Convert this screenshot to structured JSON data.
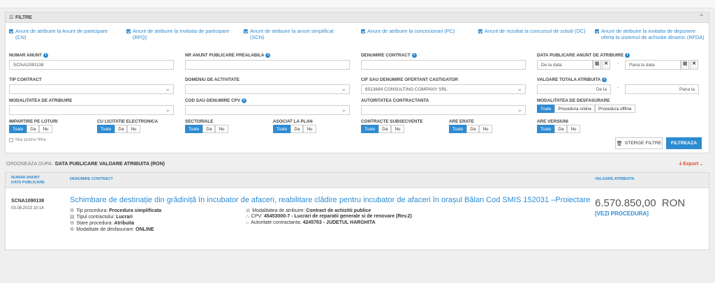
{
  "filters_header": {
    "title": "FILTRE"
  },
  "checkboxes": [
    "Anunt de atribuire la Anunt de participare (CN)",
    "Anunt de atribuire la invitatia de participare (RFQ)",
    "Anunt de atribuire la anunt simplificat (SCN)",
    "Anunt de atribuire la concesionari (PC)",
    "Anunt de rezultat la concursul de solutii (DC)",
    "Anunt de atribuire la invitatia de depunere oferta la sistemul de achizitie dinamic (RFDA)"
  ],
  "labels": {
    "numar_anunt": "NUMAR ANUNT",
    "nr_anunt_prealabil": "NR ANUNT PUBLICARE PREALABILA",
    "denumire_contract": "DENUMIRE CONTRACT",
    "data_publicare": "DATA PUBLICARE ANUNT DE ATRIBUIRE",
    "tip_contract": "TIP CONTRACT",
    "domeniu": "DOMENIU DE ACTIVITATE",
    "cif": "CIF SAU DENUMIRE OFERTANT CASTIGATOR",
    "valoare": "VALOARE TOTALA ATRIBUITA",
    "modalitate_atribuire": "MODALITATEA DE ATRIBUIRE",
    "cpv": "COD SAU DENUMIRE CPV",
    "autoritate": "AUTORITATEA CONTRACTANTA",
    "modalitate_desfasurare": "MODALITATEA DE DESFASURARE",
    "loturi": "IMPARTIRE PE LOTURI",
    "licitatie": "CU LICITATIE ELECTRONICA",
    "sectoriale": "SECTORIALE",
    "asociat": "ASOCIAT LA PLAN",
    "contracte": "CONTRACTE SUBSECVENTE",
    "erate": "ARE ERATE",
    "versiuni": "ARE VERSIUNI"
  },
  "values": {
    "numar_anunt": "SCNA1090138",
    "data_de_la": "De la data",
    "data_pana_la": "Pana la data",
    "cif": "6513684 CONSULTING COMPANY SRL",
    "valoare_de_la": "De la",
    "valoare_pana_la": "Pana la"
  },
  "seg": {
    "toate": "Toate",
    "da": "Da",
    "nu": "Nu"
  },
  "desfasurare": [
    "Toate",
    "Procedura online",
    "Procedura offline"
  ],
  "mai_putine": "Mai putine filtre",
  "buttons": {
    "sterge": "STERGE FILTRE",
    "filtreaza": "FILTREAZA",
    "export": "Export"
  },
  "sort": {
    "label": "ORDONEAZA DUPA:",
    "opt1": "DATA PUBLICARE",
    "opt2": "VALOARE ATRIBUITA (RON)"
  },
  "table_headers": {
    "col1a": "NUMAR ANUNT",
    "col1b": "DATA PUBLICARE",
    "col2": "DENUMIRE CONTRACT",
    "col3": "VALOARE ATRIBUITA"
  },
  "result": {
    "id": "SCNA1090138",
    "date": "03.08.2023 10:14",
    "title": "Schimbare de destinație din grădiniță în incubator de afaceri, reabilitare clădire pentru incubator de afaceri în orașul Bălan Cod SMIS 152031 –Proiectare faz…",
    "value": "6.570.850,00",
    "currency": "RON",
    "link": "[VEZI PROCEDURA]",
    "left_meta": [
      {
        "k": "Tip procedura:",
        "v": "Procedura simplificata"
      },
      {
        "k": "Tipul contractului:",
        "v": "Lucrari"
      },
      {
        "k": "Stare procedura:",
        "v": "Atribuita"
      },
      {
        "k": "Modalitate de desfasurare:",
        "v": "ONLINE"
      }
    ],
    "right_meta": [
      {
        "k": "Modalitatea de atribuire:",
        "v": "Contract de achizitii publice"
      },
      {
        "k": "CPV:",
        "v": "45453000-7 - Lucrari de reparatii generale si de renovare (Rev.2)"
      },
      {
        "k": "Autoritate contractanta:",
        "v": "4245763 - JUDETUL HARGHITA"
      }
    ]
  },
  "colors": {
    "accent": "#2d8bd2",
    "export": "#e24a2b"
  }
}
